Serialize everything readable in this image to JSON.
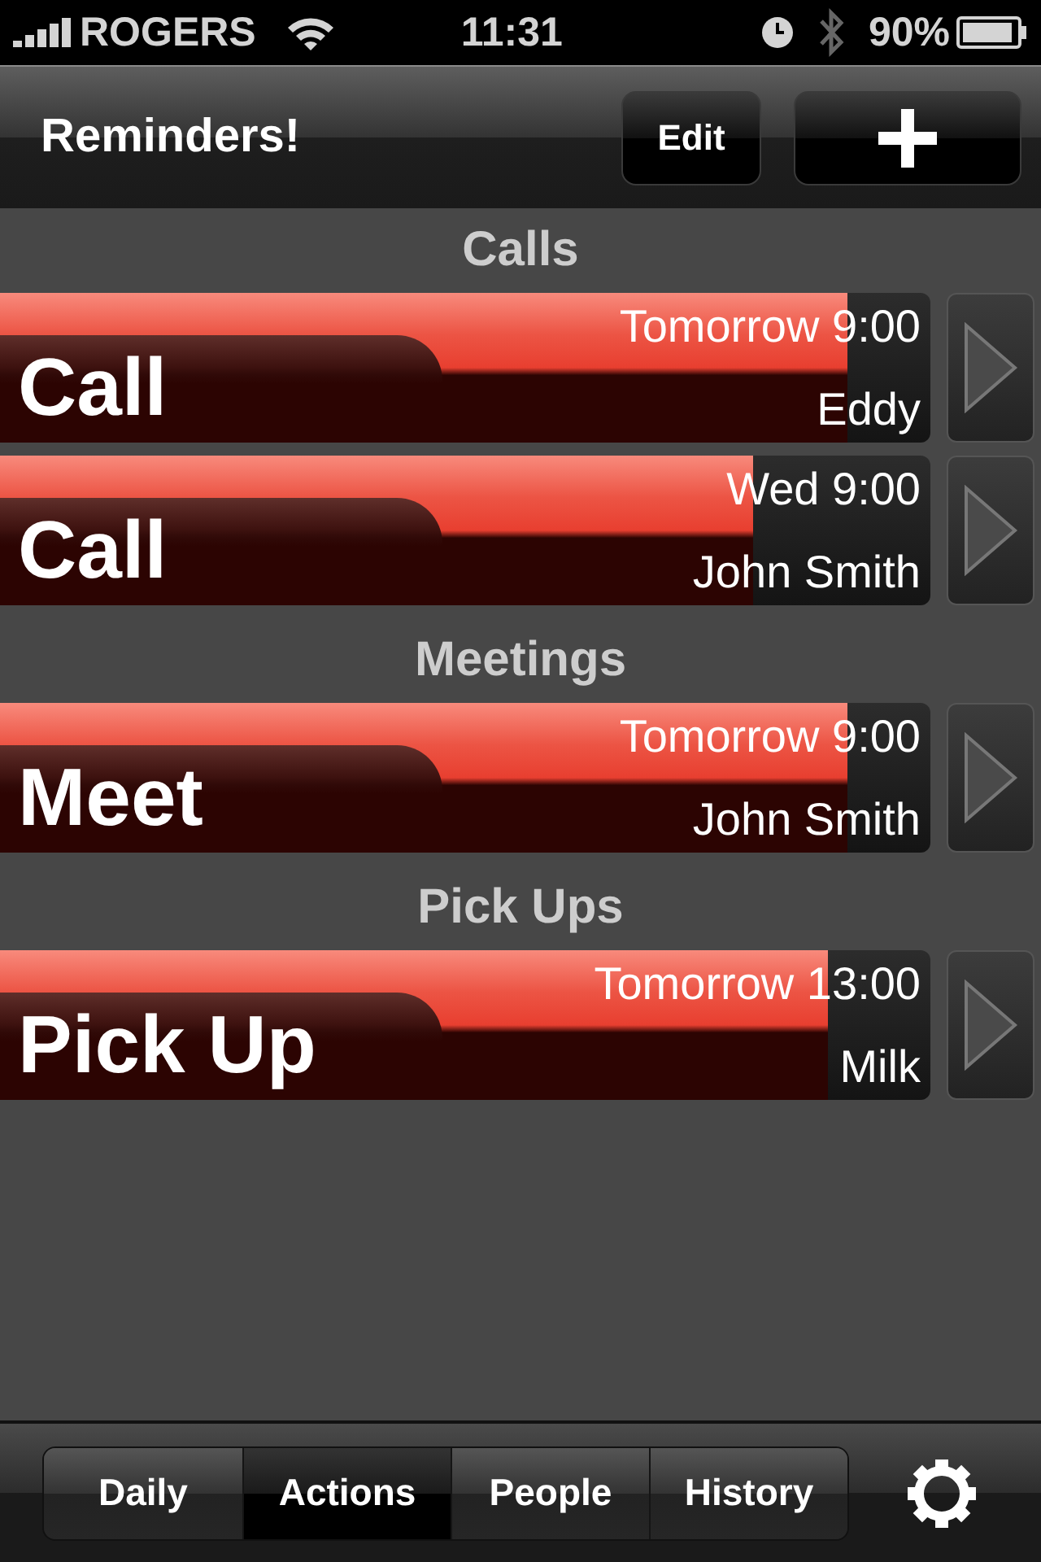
{
  "status_bar": {
    "carrier": "ROGERS",
    "time": "11:31",
    "battery": "90%"
  },
  "nav": {
    "title": "Reminders!",
    "edit": "Edit"
  },
  "groups": [
    {
      "title": "Calls",
      "items": [
        {
          "action": "Call",
          "when": "Tomorrow 9:00",
          "who": "Eddy",
          "level": 0.91
        },
        {
          "action": "Call",
          "when": "Wed 9:00",
          "who": "John Smith",
          "level": 0.81
        }
      ]
    },
    {
      "title": "Meetings",
      "items": [
        {
          "action": "Meet",
          "when": "Tomorrow 9:00",
          "who": "John Smith",
          "level": 0.91
        }
      ]
    },
    {
      "title": "Pick Ups",
      "items": [
        {
          "action": "Pick Up",
          "when": "Tomorrow 13:00",
          "who": "Milk",
          "level": 0.89
        }
      ]
    }
  ],
  "tabs": [
    {
      "label": "Daily",
      "selected": false
    },
    {
      "label": "Actions",
      "selected": true
    },
    {
      "label": "People",
      "selected": false
    },
    {
      "label": "History",
      "selected": false
    }
  ]
}
